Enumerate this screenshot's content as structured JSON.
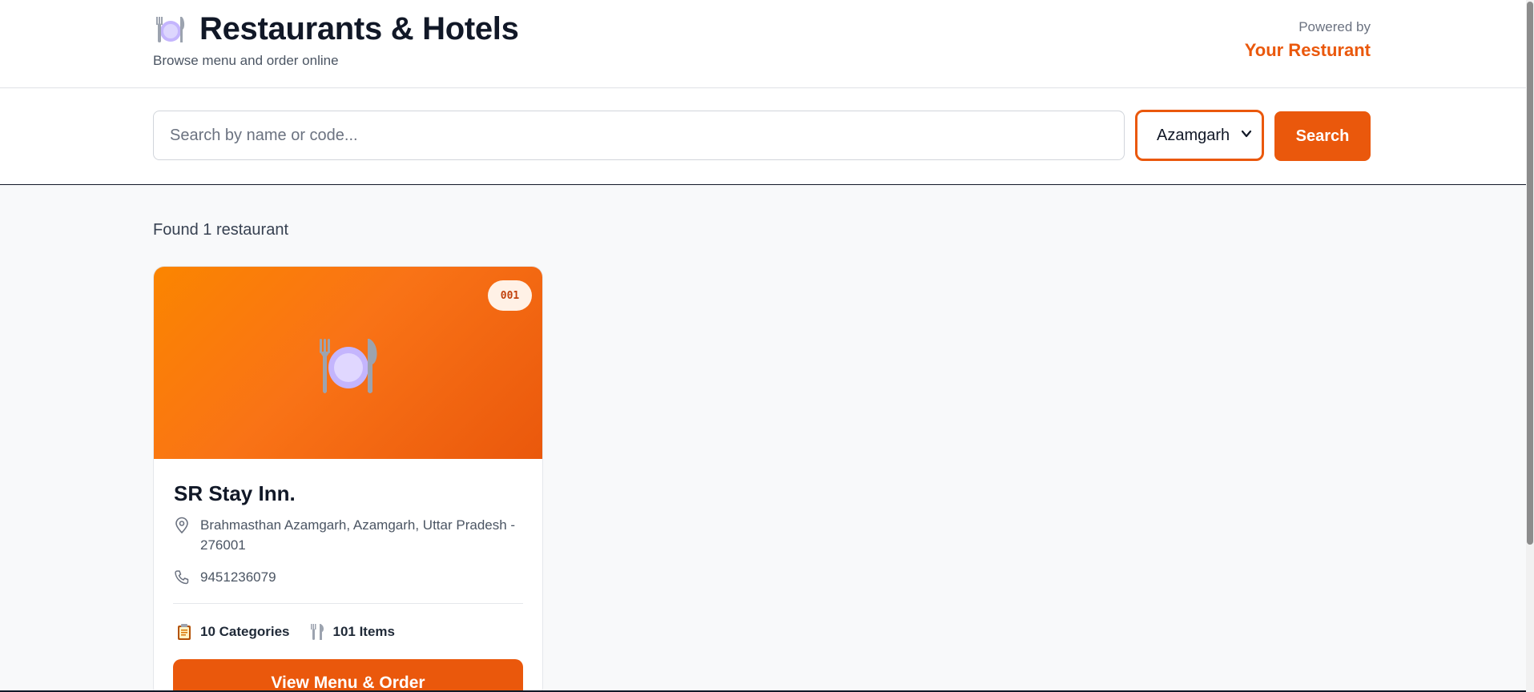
{
  "header": {
    "title": "Restaurants & Hotels",
    "subtitle": "Browse menu and order online",
    "powered_label": "Powered by",
    "powered_name": "Your Resturant",
    "icon": "plate-fork-knife-icon"
  },
  "search": {
    "placeholder": "Search by name or code...",
    "value": "",
    "city": "Azamgarh",
    "button_label": "Search"
  },
  "results": {
    "found_text": "Found 1 restaurant",
    "restaurants": [
      {
        "code": "001",
        "name": "SR Stay Inn.",
        "address_line1": "Brahmasthan Azamgarh, Azamgarh, Uttar Pradesh -",
        "address_line2": "276001",
        "phone": "9451236079",
        "categories": "10 Categories",
        "items": "101 Items",
        "button_label": "View Menu & Order",
        "hero_icon": "plate-fork-knife-icon"
      }
    ]
  },
  "colors": {
    "accent": "#ea580c",
    "hero_gradient_start": "#fb8500",
    "hero_gradient_end": "#ea580c"
  }
}
